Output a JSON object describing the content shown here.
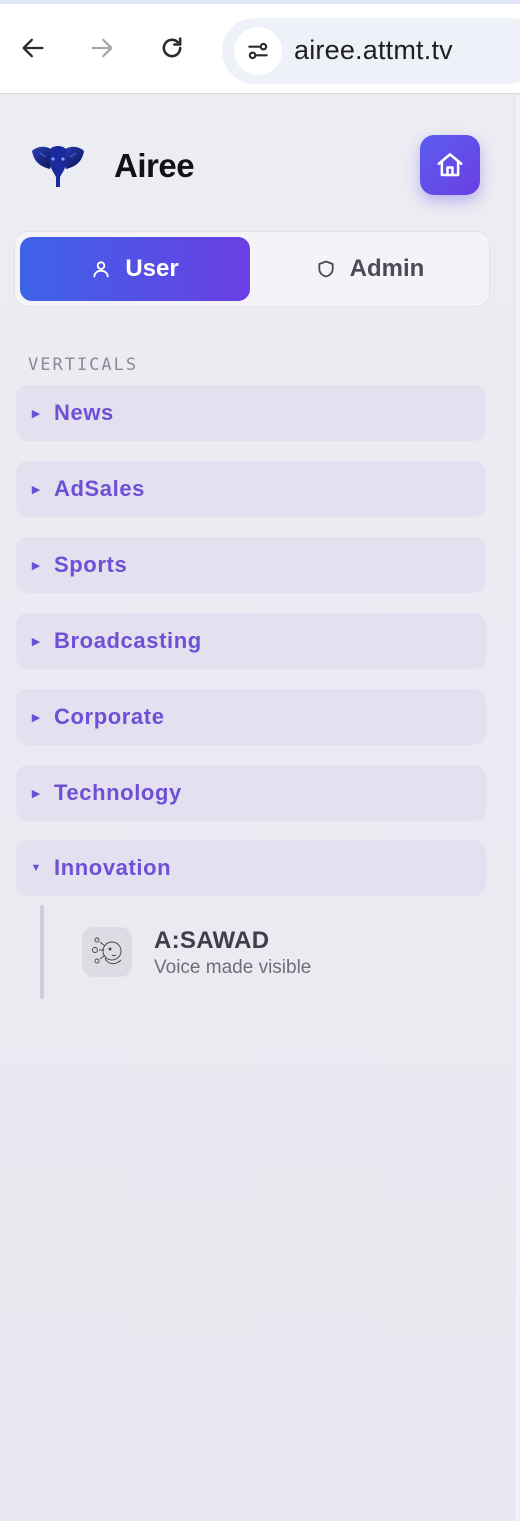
{
  "browser": {
    "url": "airee.attmt.tv",
    "back_icon": "arrow-left-icon",
    "forward_icon": "arrow-right-icon",
    "reload_icon": "reload-icon",
    "site_info_icon": "site-settings-icon"
  },
  "brand": {
    "name": "Airee",
    "logo": "elephant-logo"
  },
  "mode_toggle": {
    "user_label": "User",
    "admin_label": "Admin",
    "active": "User"
  },
  "sidebar": {
    "section_label": "VERTICALS",
    "verticals": [
      {
        "label": "News",
        "expanded": false
      },
      {
        "label": "AdSales",
        "expanded": false
      },
      {
        "label": "Sports",
        "expanded": false
      },
      {
        "label": "Broadcasting",
        "expanded": false
      },
      {
        "label": "Corporate",
        "expanded": false
      },
      {
        "label": "Technology",
        "expanded": false
      },
      {
        "label": "Innovation",
        "expanded": true
      }
    ],
    "innovation_items": [
      {
        "title": "A:SAWAD",
        "tagline": "Voice made visible"
      }
    ]
  },
  "colors": {
    "accent": "#6a3fe3",
    "accent_blue": "#3d63e8",
    "vertical_bg": "#e3e1ef",
    "vertical_text": "#6e4fd6"
  }
}
